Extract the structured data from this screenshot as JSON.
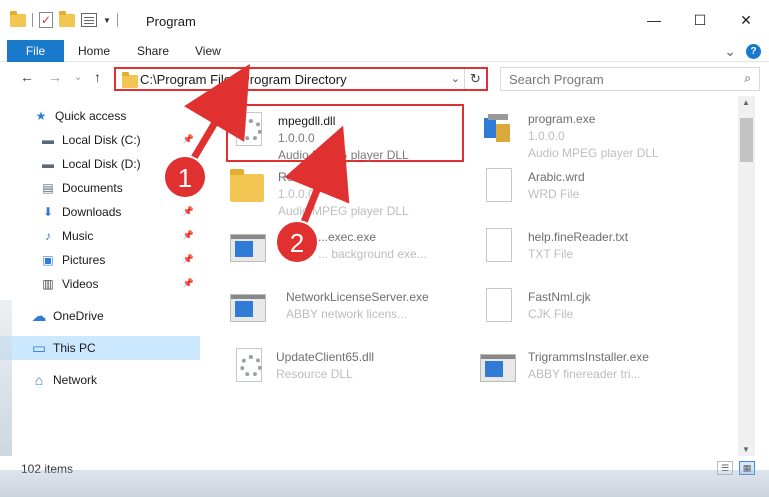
{
  "window": {
    "title": "Program",
    "controls": {
      "minimize": "—",
      "maximize": "☐",
      "close": "✕"
    }
  },
  "ribbon": {
    "file_tab": "File",
    "tabs": [
      "Home",
      "Share",
      "View"
    ],
    "expand_glyph": "⌄",
    "help_glyph": "?"
  },
  "nav": {
    "back": "←",
    "forward": "→",
    "history": "⌄",
    "up": "↑",
    "address_path": "C:\\Program Files\\Program Directory",
    "address_dropdown": "⌄",
    "refresh": "↻",
    "search_placeholder": "Search Program",
    "search_glyph": "⌕"
  },
  "sidebar": {
    "items": [
      {
        "label": "Quick access",
        "icon": "star-icon",
        "glyph": "★",
        "color": "#2f7bd6",
        "pinned": false
      },
      {
        "label": "Local Disk (C:)",
        "icon": "drive-icon",
        "glyph": "▬",
        "color": "#5a6b7a",
        "pinned": true
      },
      {
        "label": "Local Disk (D:)",
        "icon": "drive-icon",
        "glyph": "▬",
        "color": "#5a6b7a",
        "pinned": true
      },
      {
        "label": "Documents",
        "icon": "documents-icon",
        "glyph": "▤",
        "color": "#5a6b7a",
        "pinned": true
      },
      {
        "label": "Downloads",
        "icon": "download-arrow-icon",
        "glyph": "⬇",
        "color": "#2f7bd6",
        "pinned": true
      },
      {
        "label": "Music",
        "icon": "music-note-icon",
        "glyph": "♪",
        "color": "#2f7bd6",
        "pinned": true
      },
      {
        "label": "Pictures",
        "icon": "pictures-icon",
        "glyph": "▣",
        "color": "#2f7bd6",
        "pinned": true
      },
      {
        "label": "Videos",
        "icon": "film-icon",
        "glyph": "▥",
        "color": "#444444",
        "pinned": true
      },
      {
        "label": "OneDrive",
        "icon": "cloud-icon",
        "glyph": "☁",
        "color": "#2f7bd6",
        "pinned": false
      },
      {
        "label": "This PC",
        "icon": "monitor-icon",
        "glyph": "▭",
        "color": "#2f7bd6",
        "pinned": false,
        "selected": true
      },
      {
        "label": "Network",
        "icon": "network-icon",
        "glyph": "⌂",
        "color": "#2f7bd6",
        "pinned": false
      }
    ]
  },
  "files": [
    {
      "name": "mpegdll.dll",
      "line1": "1.0.0.0",
      "line2": "Audio MPEG player DLL",
      "icon": "dll-gear-icon",
      "highlight": true
    },
    {
      "name": "program.exe",
      "line1": "1.0.0.0",
      "line2": "Audio MPEG player DLL",
      "icon": "installer-package-icon",
      "faded": true
    },
    {
      "name": "Reso...",
      "line1": "1.0.0.0",
      "line2": "Audio MPEG player DLL",
      "icon": "folder-icon",
      "faded": true
    },
    {
      "name": "Arabic.wrd",
      "line1": "WRD File",
      "line2": "",
      "icon": "blank-document-icon",
      "faded": true
    },
    {
      "name": "...exec.exe",
      "line1": "... background exe...",
      "line2": "",
      "icon": "exe-window-icon",
      "faded": true
    },
    {
      "name": "help.fineReader.txt",
      "line1": "TXT File",
      "line2": "",
      "icon": "blank-document-icon",
      "faded": true
    },
    {
      "name": "NetworkLicenseServer.exe",
      "line1": "ABBY network licens...",
      "line2": "",
      "icon": "exe-window-icon",
      "faded": true
    },
    {
      "name": "FastNml.cjk",
      "line1": "CJK File",
      "line2": "",
      "icon": "blank-document-icon",
      "faded": true
    },
    {
      "name": "UpdateClient65.dll",
      "line1": "Resource DLL",
      "line2": "",
      "icon": "dll-gear-icon",
      "faded": true
    },
    {
      "name": "TrigrammsInstaller.exe",
      "line1": "ABBY finereader tri...",
      "line2": "",
      "icon": "exe-window-icon",
      "faded": true
    }
  ],
  "status": {
    "item_count": "102 items"
  },
  "callouts": [
    {
      "number": "1"
    },
    {
      "number": "2"
    }
  ],
  "colors": {
    "accent": "#1979ca",
    "callout_red": "#e03030",
    "selected_bg": "#cce8ff"
  }
}
